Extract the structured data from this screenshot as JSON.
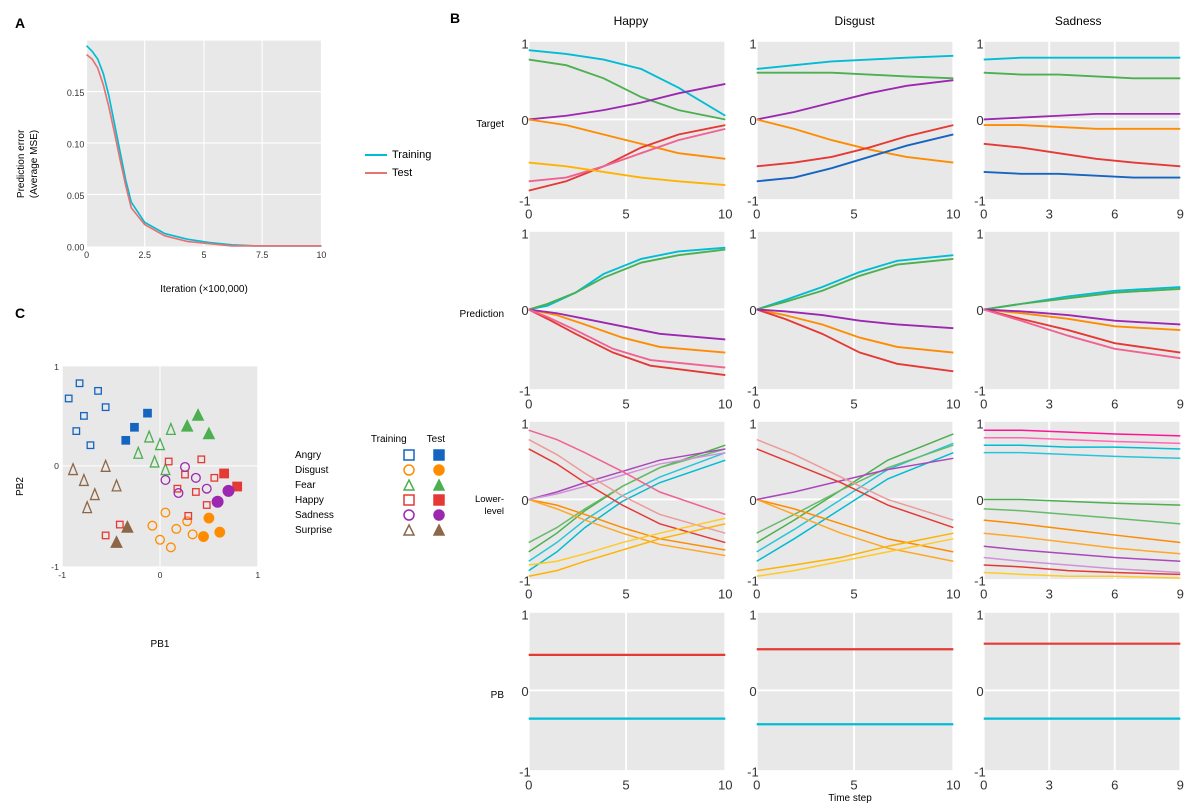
{
  "panelA": {
    "label": "A",
    "yAxisLabel": "Prediction error\n(Average MSE)",
    "xAxisLabel": "Iteration (×100,000)",
    "legend": {
      "training": {
        "label": "Training",
        "color": "#00bcd4"
      },
      "test": {
        "label": "Test",
        "color": "#e57373"
      }
    },
    "xTicks": [
      "0",
      "2.5",
      "5",
      "7.5",
      "10"
    ],
    "yTicks": [
      "0.00",
      "0.05",
      "0.10",
      "0.15"
    ]
  },
  "panelB": {
    "label": "B",
    "colHeaders": [
      "Happy",
      "Disgust",
      "Sadness"
    ],
    "rowLabels": [
      "Target",
      "Prediction",
      "Lower-\nlevel",
      "PB"
    ],
    "xTicksNormal": [
      "0",
      "5",
      "10"
    ],
    "xTicksSadness": [
      "0",
      "3",
      "6",
      "9"
    ],
    "yTicks": [
      "-1",
      "0",
      "1"
    ],
    "xAxisLabel": "Time step"
  },
  "panelC": {
    "label": "C",
    "xAxisLabel": "PB1",
    "yAxisLabel": "PB2",
    "xTicks": [
      "-1",
      "0",
      "1"
    ],
    "yTicks": [
      "-1",
      "0",
      "1"
    ],
    "legendHeaders": [
      "Training",
      "Test"
    ],
    "legendItems": [
      {
        "label": "Angry",
        "trainColor": "#1565c0",
        "trainFill": "none",
        "testColor": "#1565c0",
        "testFill": "#1565c0",
        "trainShape": "square",
        "testShape": "square"
      },
      {
        "label": "Disgust",
        "trainColor": "#ff8c00",
        "trainFill": "none",
        "testColor": "#ff8c00",
        "testFill": "#ff8c00",
        "trainShape": "circle",
        "testShape": "circle"
      },
      {
        "label": "Fear",
        "trainColor": "#4caf50",
        "trainFill": "none",
        "testColor": "#4caf50",
        "testFill": "#4caf50",
        "trainShape": "triangle",
        "testShape": "triangle"
      },
      {
        "label": "Happy",
        "trainColor": "#e53935",
        "trainFill": "none",
        "testColor": "#e53935",
        "testFill": "#e53935",
        "trainShape": "square",
        "testShape": "square"
      },
      {
        "label": "Sadness",
        "trainColor": "#9c27b0",
        "trainFill": "none",
        "testColor": "#9c27b0",
        "testFill": "#9c27b0",
        "trainShape": "circle",
        "testShape": "circle"
      },
      {
        "label": "Surprise",
        "trainColor": "#8d6748",
        "trainFill": "none",
        "testColor": "#8d6748",
        "testFill": "#8d6748",
        "trainShape": "triangle",
        "testShape": "triangle"
      }
    ]
  }
}
